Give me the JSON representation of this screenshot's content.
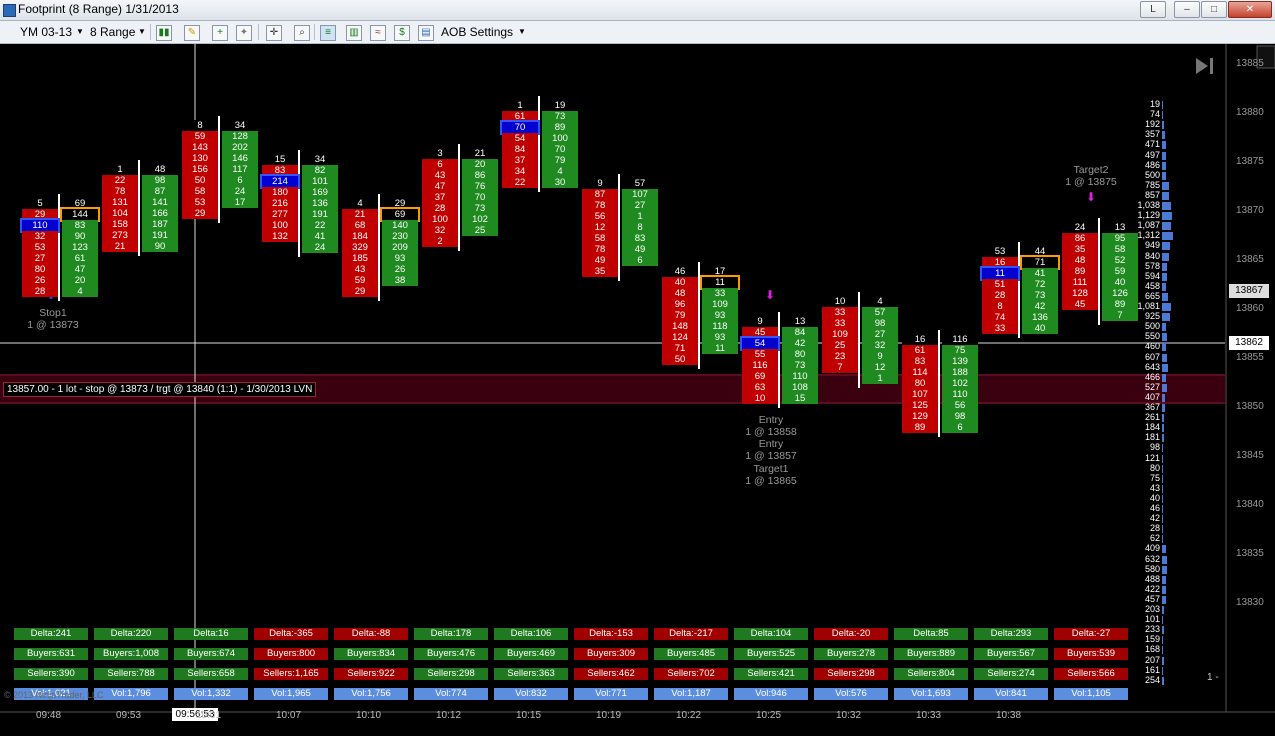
{
  "window": {
    "title": "Footprint (8 Range)  1/31/2013"
  },
  "toolbar": {
    "instrument": "YM 03-13",
    "period": "8 Range",
    "aob_settings": "AOB Settings"
  },
  "chart": {
    "price_axis_labels": [
      "13885",
      "13880",
      "13875",
      "13870",
      "13865",
      "13860",
      "13855",
      "13850",
      "13845",
      "13840",
      "13835",
      "13830"
    ],
    "last_price_badge": "13867",
    "crosshair_price_badge": "13862",
    "time_labels": [
      "09:48",
      "09:53",
      "10:01",
      "10:07",
      "10:10",
      "10:12",
      "10:15",
      "10:19",
      "10:22",
      "10:25",
      "10:32",
      "10:33",
      "10:38"
    ],
    "crosshair_time_badge": "09:56:53",
    "zone_label": "13857.00 - 1 lot - stop @ 13873 / trgt @ 13840 (1:1) - 1/30/2013 LVN",
    "annotations": {
      "stop1": "Stop1",
      "stop1_detail": "1 @ 13873",
      "entry1": "Entry",
      "entry1_detail": "1 @ 13858",
      "entry2": "Entry",
      "entry2_detail": "1 @ 13857",
      "target1": "Target1",
      "target1_detail": "1 @ 13865",
      "target2": "Target2",
      "target2_detail": "1 @ 13875"
    },
    "copyright": "© 2013 NinjaTrader, LLC",
    "volume_profile": [
      "19",
      "74",
      "192",
      "357",
      "471",
      "497",
      "486",
      "500",
      "785",
      "857",
      "1,038",
      "1,129",
      "1,087",
      "1,312",
      "949",
      "840",
      "578",
      "594",
      "458",
      "665",
      "1,081",
      "925",
      "500",
      "550",
      "460",
      "607",
      "643",
      "466",
      "527",
      "407",
      "367",
      "261",
      "184",
      "181",
      "98",
      "121",
      "80",
      "75",
      "43",
      "40",
      "46",
      "42",
      "28",
      "62",
      "409",
      "632",
      "580",
      "488",
      "422",
      "457",
      "203",
      "101",
      "233",
      "159",
      "168",
      "207",
      "161",
      "254"
    ],
    "summary": {
      "delta": [
        "Delta:241",
        "Delta:220",
        "Delta:16",
        "Delta:-365",
        "Delta:-88",
        "Delta:178",
        "Delta:106",
        "Delta:-153",
        "Delta:-217",
        "Delta:104",
        "Delta:-20",
        "Delta:85",
        "Delta:293",
        "Delta:-27"
      ],
      "buyers": [
        "Buyers:631",
        "Buyers:1,008",
        "Buyers:674",
        "Buyers:800",
        "Buyers:834",
        "Buyers:476",
        "Buyers:469",
        "Buyers:309",
        "Buyers:485",
        "Buyers:525",
        "Buyers:278",
        "Buyers:889",
        "Buyers:567",
        "Buyers:539"
      ],
      "sellers": [
        "Sellers:390",
        "Sellers:788",
        "Sellers:658",
        "Sellers:1,165",
        "Sellers:922",
        "Sellers:298",
        "Sellers:363",
        "Sellers:462",
        "Sellers:702",
        "Sellers:421",
        "Sellers:298",
        "Sellers:804",
        "Sellers:274",
        "Sellers:566"
      ],
      "vol": [
        "Vol:1,021",
        "Vol:1,796",
        "Vol:1,332",
        "Vol:1,965",
        "Vol:1,756",
        "Vol:774",
        "Vol:832",
        "Vol:771",
        "Vol:1,187",
        "Vol:946",
        "Vol:576",
        "Vol:1,693",
        "Vol:841",
        "Vol:1,105"
      ]
    },
    "bars": [
      {
        "sell": [
          "5",
          "29",
          "110",
          "32",
          "53",
          "27",
          "80",
          "26",
          "28"
        ],
        "buy": [
          "69",
          "144",
          "83",
          "90",
          "123",
          "61",
          "47",
          "20",
          "4"
        ]
      },
      {
        "sell": [
          "1",
          "22",
          "78",
          "131",
          "104",
          "158",
          "273",
          "21"
        ],
        "buy": [
          "48",
          "98",
          "87",
          "141",
          "166",
          "187",
          "191",
          "90"
        ]
      },
      {
        "sell": [
          "8",
          "59",
          "143",
          "130",
          "156",
          "50",
          "58",
          "53",
          "29"
        ],
        "buy": [
          "34",
          "128",
          "202",
          "146",
          "117",
          "6",
          "24",
          "17"
        ]
      },
      {
        "sell": [
          "15",
          "83",
          "214",
          "180",
          "216",
          "277",
          "100",
          "132"
        ],
        "buy": [
          "34",
          "82",
          "101",
          "169",
          "136",
          "191",
          "22",
          "41",
          "24"
        ]
      },
      {
        "sell": [
          "4",
          "21",
          "68",
          "184",
          "329",
          "185",
          "43",
          "59",
          "29"
        ],
        "buy": [
          "29",
          "69",
          "140",
          "230",
          "209",
          "93",
          "26",
          "38"
        ]
      },
      {
        "sell": [
          "3",
          "6",
          "43",
          "47",
          "37",
          "28",
          "100",
          "32",
          "2"
        ],
        "buy": [
          "21",
          "20",
          "86",
          "76",
          "70",
          "73",
          "102",
          "25"
        ]
      },
      {
        "sell": [
          "1",
          "61",
          "70",
          "54",
          "84",
          "37",
          "34",
          "22"
        ],
        "buy": [
          "19",
          "73",
          "89",
          "100",
          "70",
          "79",
          "4",
          "30"
        ]
      },
      {
        "sell": [
          "9",
          "87",
          "78",
          "56",
          "12",
          "58",
          "78",
          "49",
          "35"
        ],
        "buy": [
          "57",
          "107",
          "27",
          "1",
          "8",
          "83",
          "49",
          "6"
        ]
      },
      {
        "sell": [
          "46",
          "40",
          "48",
          "96",
          "79",
          "148",
          "124",
          "71",
          "50"
        ],
        "buy": [
          "17",
          "11",
          "33",
          "109",
          "93",
          "118",
          "93",
          "11"
        ]
      },
      {
        "sell": [
          "9",
          "45",
          "54",
          "55",
          "116",
          "69",
          "63",
          "10"
        ],
        "buy": [
          "13",
          "84",
          "42",
          "80",
          "73",
          "110",
          "108",
          "15"
        ]
      },
      {
        "sell": [
          "10",
          "33",
          "33",
          "109",
          "25",
          "23",
          "7"
        ],
        "buy": [
          "4",
          "57",
          "98",
          "27",
          "32",
          "9",
          "12",
          "1"
        ]
      },
      {
        "sell": [
          "16",
          "61",
          "83",
          "114",
          "80",
          "107",
          "125",
          "129",
          "89"
        ],
        "buy": [
          "116",
          "75",
          "139",
          "188",
          "102",
          "110",
          "56",
          "98",
          "6"
        ]
      },
      {
        "sell": [
          "53",
          "16",
          "11",
          "51",
          "28",
          "8",
          "74",
          "33"
        ],
        "buy": [
          "44",
          "71",
          "41",
          "72",
          "73",
          "42",
          "136",
          "40"
        ]
      },
      {
        "sell": [
          "24",
          "86",
          "35",
          "48",
          "89",
          "111",
          "128",
          "45"
        ],
        "buy": [
          "13",
          "95",
          "58",
          "52",
          "59",
          "40",
          "126",
          "89",
          "7"
        ]
      }
    ]
  }
}
